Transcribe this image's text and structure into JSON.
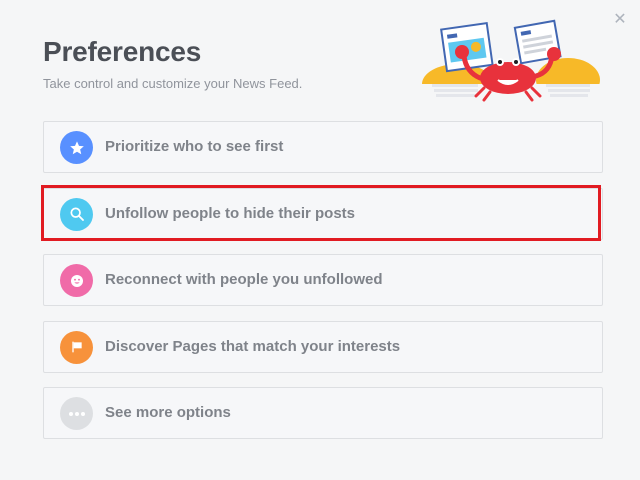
{
  "dialog": {
    "title": "Preferences",
    "subtitle": "Take control and customize your News Feed.",
    "close_icon": "close-icon"
  },
  "options": [
    {
      "label": "Prioritize who to see first",
      "icon": "star-icon",
      "color": "#5890ff"
    },
    {
      "label": "Unfollow people to hide their posts",
      "icon": "search-icon",
      "color": "#4fc9f0",
      "highlighted": true
    },
    {
      "label": "Reconnect with people you unfollowed",
      "icon": "smiley-icon",
      "color": "#f06ba8"
    },
    {
      "label": "Discover Pages that match your interests",
      "icon": "flag-icon",
      "color": "#f7923b"
    },
    {
      "label": "See more options",
      "icon": "more-icon",
      "color": "#dddfe2"
    }
  ],
  "colors": {
    "highlight_border": "#e11b22",
    "title_text": "#4b4f56",
    "option_text": "#7f838a"
  }
}
